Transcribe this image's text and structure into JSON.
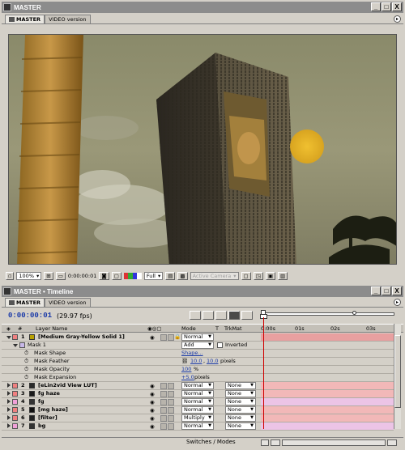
{
  "composition_window": {
    "title": "MASTER",
    "tabs": [
      {
        "label": "MASTER",
        "active": true
      },
      {
        "label": "VIDEO version",
        "active": false
      }
    ],
    "window_buttons": [
      "_",
      "□",
      "X"
    ]
  },
  "viewer_toolbar": {
    "zoom": "100%",
    "timecode": "0:00:00:01",
    "resolution": "Full",
    "camera": "Active Camera"
  },
  "timeline_window": {
    "title": "MASTER • Timeline",
    "tabs": [
      {
        "label": "MASTER",
        "active": true
      },
      {
        "label": "VIDEO version",
        "active": false
      }
    ],
    "timecode": "0:00:00:01",
    "fps": "(29.97 fps)",
    "columns": {
      "layer_name": "Layer Name",
      "mode": "Mode",
      "t": "T",
      "trkmat": "TrkMat"
    },
    "ruler": [
      "0:00s",
      "01s",
      "02s",
      "03s"
    ],
    "rows": [
      {
        "idx": "1",
        "name": "[Medium Gray-Yellow Solid 1]",
        "mode": "Normal",
        "trkmat": "",
        "expanded": true,
        "swatch": "#b8a000"
      },
      {
        "idx": "",
        "name": "Mask 1",
        "mask_mode": "Add",
        "inverted_label": "Inverted"
      },
      {
        "prop": "Mask Shape",
        "value": "Shape..."
      },
      {
        "prop": "Mask Feather",
        "value_a": "10.0",
        "sep": ",",
        "value_b": "10.0",
        "unit": "pixels"
      },
      {
        "prop": "Mask Opacity",
        "value": "100",
        "unit": "%"
      },
      {
        "prop": "Mask Expansion",
        "value": "+5.0",
        "unit": "pixels"
      },
      {
        "idx": "2",
        "name": "[eLin2vid View LUT]",
        "mode": "Normal",
        "trkmat": "None",
        "swatch": "#2a2a2a"
      },
      {
        "idx": "3",
        "name": "fg haze",
        "mode": "Normal",
        "trkmat": "None",
        "swatch": "#1a1a1a"
      },
      {
        "idx": "4",
        "name": "fg",
        "mode": "Normal",
        "trkmat": "None",
        "swatch": "#333333"
      },
      {
        "idx": "5",
        "name": "[mg haze]",
        "mode": "Normal",
        "trkmat": "None",
        "swatch": "#111111"
      },
      {
        "idx": "6",
        "name": "[filter]",
        "mode": "Multiply",
        "trkmat": "None",
        "swatch": "#222222"
      },
      {
        "idx": "7",
        "name": "bg",
        "mode": "Normal",
        "trkmat": "None",
        "swatch": "#333333"
      }
    ],
    "footer": "Switches / Modes"
  },
  "colors": {
    "timecode_blue": "#1a3aa8",
    "cti_red": "#d00000",
    "bar_pink": "#f2b8b8"
  }
}
